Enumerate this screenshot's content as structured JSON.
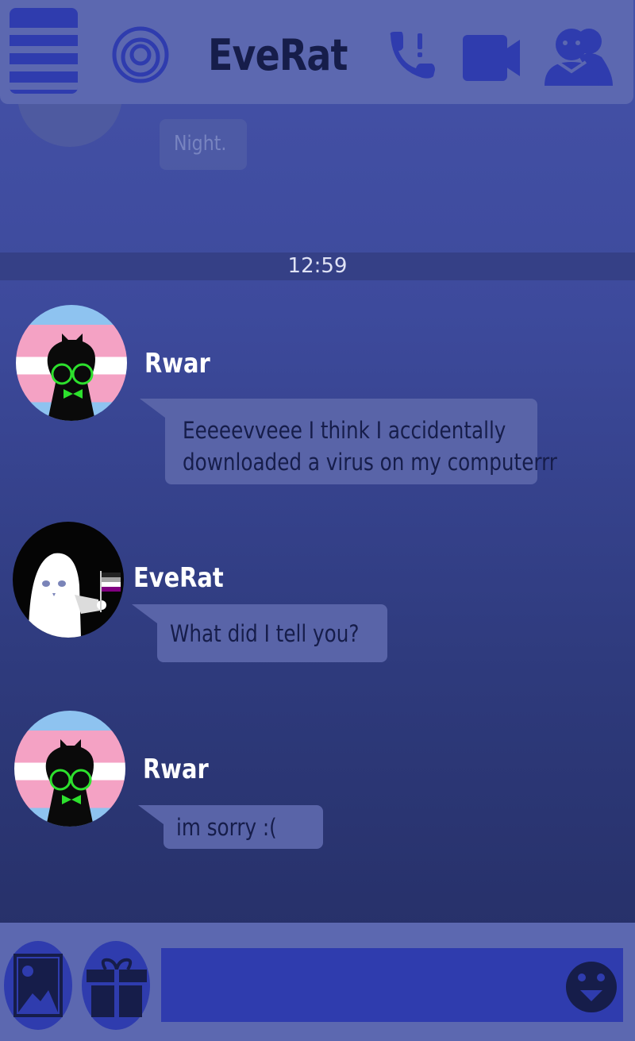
{
  "header": {
    "title": "EveRat",
    "icons": [
      "menu-icon",
      "target-icon",
      "call-alert-icon",
      "video-camera-icon",
      "group-icon"
    ]
  },
  "previous_message": {
    "text": "Night."
  },
  "divider": {
    "time": "12:59"
  },
  "messages": [
    {
      "sender": "Rwar",
      "text_lines": [
        "Eeeeevveee I think I accidentally",
        "downloaded a virus on my computerrr"
      ],
      "avatar": "trans-flag-cat-avatar"
    },
    {
      "sender": "EveRat",
      "text_lines": [
        "What did I tell you?"
      ],
      "avatar": "ghost-ace-flag-avatar"
    },
    {
      "sender": "Rwar",
      "text_lines": [
        "im sorry :("
      ],
      "avatar": "trans-flag-cat-avatar"
    }
  ],
  "composer": {
    "value": "",
    "icons": [
      "image-icon",
      "gift-icon",
      "emoji-icon"
    ]
  },
  "colors": {
    "header": "#5c68b0",
    "accent": "#2f3cae",
    "bubble": "#5964a8",
    "title_text": "#161d4a"
  }
}
